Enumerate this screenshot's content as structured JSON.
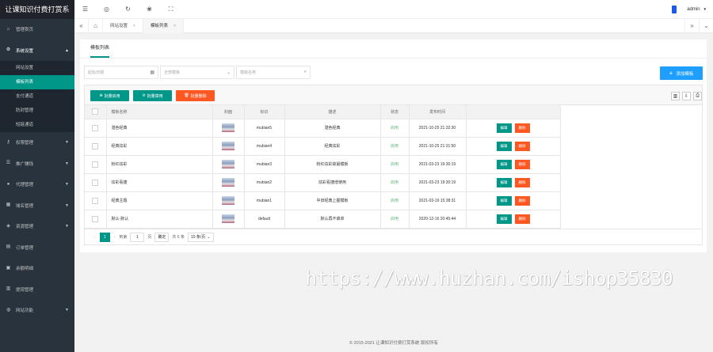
{
  "app": {
    "title": "让课知识付费打赏系",
    "user": "admin"
  },
  "sidebar": {
    "items": [
      {
        "label": "管理首页",
        "icon": "home-icon"
      },
      {
        "label": "系统设置",
        "icon": "gear-icon",
        "expanded": true,
        "children": [
          {
            "label": "网站设置"
          },
          {
            "label": "模板列表",
            "active": true
          },
          {
            "label": "支付通道"
          },
          {
            "label": "防封管理"
          },
          {
            "label": "短链通道"
          }
        ]
      },
      {
        "label": "权限管理",
        "icon": "key-icon"
      },
      {
        "label": "推广赚钱",
        "icon": "list-icon"
      },
      {
        "label": "代理管理",
        "icon": "user-icon"
      },
      {
        "label": "域名管理",
        "icon": "grid-icon"
      },
      {
        "label": "资源管理",
        "icon": "layers-icon"
      },
      {
        "label": "订单管理",
        "icon": "order-icon"
      },
      {
        "label": "余额明细",
        "icon": "wallet-icon"
      },
      {
        "label": "提现管理",
        "icon": "cash-icon"
      },
      {
        "label": "网站功能",
        "icon": "globe-icon"
      }
    ]
  },
  "tabs": [
    {
      "label": "网站设置"
    },
    {
      "label": "模板列表",
      "active": true
    }
  ],
  "panel": {
    "title": "模板列表"
  },
  "filters": {
    "date_placeholder": "起始日期",
    "status_placeholder": "全部模板",
    "search_placeholder": "模版名称"
  },
  "toolbar": {
    "add_label": "添加模板",
    "enable_label": "批量启用",
    "disable_label": "批量禁用",
    "delete_label": "批量删除"
  },
  "table": {
    "headers": [
      "模板名称",
      "封面",
      "标识",
      "描述",
      "状态",
      "发布时间",
      ""
    ],
    "rows": [
      {
        "name": "湛色经典",
        "id": "mubian5",
        "desc": "湛色经典",
        "status": "启用",
        "time": "2021-10-25 21:32:30"
      },
      {
        "name": "经典炫彩",
        "id": "mubian4",
        "desc": "经典炫彩",
        "status": "启用",
        "time": "2021-10-25 21:31:50"
      },
      {
        "name": "粉红炫彩",
        "id": "mubian3",
        "desc": "粉红炫彩故最模板",
        "status": "启用",
        "time": "2021-03-23 19:30:19"
      },
      {
        "name": "炫彩看捷",
        "id": "mubian2",
        "desc": "炫彩看捷增使用",
        "status": "启用",
        "time": "2021-03-23 19:30:19"
      },
      {
        "name": "经典主题",
        "id": "mubian1",
        "desc": "中旧经典上握模板",
        "status": "启用",
        "time": "2021-03-19 15:38:31"
      },
      {
        "name": "默认-默认",
        "id": "default",
        "desc": "默认再不谁单",
        "status": "启用",
        "time": "2020-12-16 20:45:44"
      }
    ],
    "edit_label": "编辑",
    "delete_label": "删除"
  },
  "pagination": {
    "current": "1",
    "goto_label": "到第",
    "page_input": "1",
    "page_unit": "页",
    "confirm_label": "确定",
    "total": "共 6 条",
    "page_size": "10 条/页"
  },
  "watermark": "https://www.huzhan.com/ishop35830",
  "footer": "© 2015-2021 让课知识付费打赏系统 版权所有",
  "colors": {
    "accent": "#009688",
    "blue": "#1e9fff",
    "orange": "#ff5722",
    "sidebar": "#28333e"
  }
}
